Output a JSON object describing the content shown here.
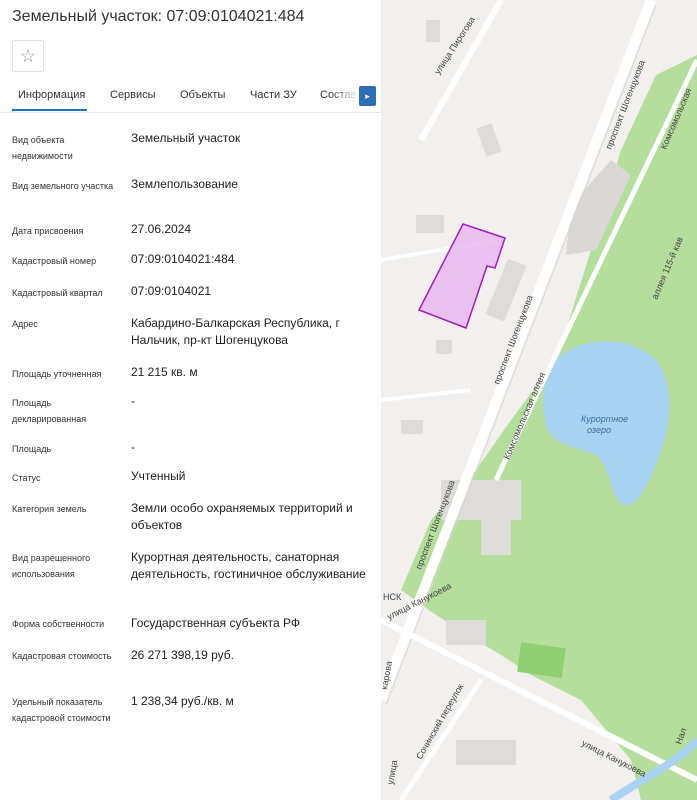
{
  "header": {
    "title": "Земельный участок: 07:09:0104021:484"
  },
  "toolbar": {
    "star_icon": "☆"
  },
  "tabs": [
    {
      "label": "Информация",
      "active": true
    },
    {
      "label": "Сервисы"
    },
    {
      "label": "Объекты"
    },
    {
      "label": "Части ЗУ"
    },
    {
      "label": "Состав"
    }
  ],
  "tab_scroll_icon": "▸",
  "info": [
    {
      "label": "Вид объекта недвижимости",
      "value": "Земельный участок"
    },
    {
      "label": "Вид земельного участка",
      "value": "Землепользование"
    },
    {
      "label": "Дата присвоения",
      "value": "27.06.2024"
    },
    {
      "label": "Кадастровый номер",
      "value": "07:09:0104021:484"
    },
    {
      "label": "Кадастровый квартал",
      "value": "07:09:0104021"
    },
    {
      "label": "Адрес",
      "value": "Кабардино-Балкарская Республика, г Нальчик, пр-кт Шогенцукова"
    },
    {
      "label": "Площадь уточненная",
      "value": "21 215 кв. м"
    },
    {
      "label": "Площадь декларированная",
      "value": "-"
    },
    {
      "label": "Площадь",
      "value": "-"
    },
    {
      "label": "Статус",
      "value": "Учтенный"
    },
    {
      "label": "Категория земель",
      "value": "Земли особо охраняемых территорий и объектов"
    },
    {
      "label": "Вид разрешенного использования",
      "value": "Курортная деятельность, санаторная деятельность, гостиничное обслуживание"
    },
    {
      "label": "Форма собственности",
      "value": "Государственная субъекта РФ"
    },
    {
      "label": "Кадастровая стоимость",
      "value": "26 271 398,19 руб."
    },
    {
      "label": "Удельный показатель кадастровой стоимости",
      "value": "1 238,34 руб./кв. м"
    }
  ],
  "map": {
    "labels": {
      "street_pirogova": "улица Пирогова",
      "prospekt_1": "проспект Шогенцукова",
      "prospekt_2": "проспект Шогенцукова",
      "prospekt_3": "проспект Шогенцукова",
      "komsomolskaya_1": "Комсомольская",
      "komsomolskaya_alley": "Комсомольская аллея",
      "alley_115": "аллея 115-й кав",
      "lake": "Курортное\nозеро",
      "kanukoeva_1": "улица Канукоева",
      "kanukoeva_2": "улица Канукоева",
      "sochinsky": "Сочинский переулок",
      "karova": "карова",
      "ulitsa": "улица",
      "nsk": "НСК",
      "nal": "Нал"
    },
    "colors": {
      "background": "#f1f0ee",
      "park": "#b5dd9c",
      "water": "#a9d3f2",
      "parcel_fill": "#e6b8ee",
      "parcel_stroke": "#a31cc0"
    }
  }
}
